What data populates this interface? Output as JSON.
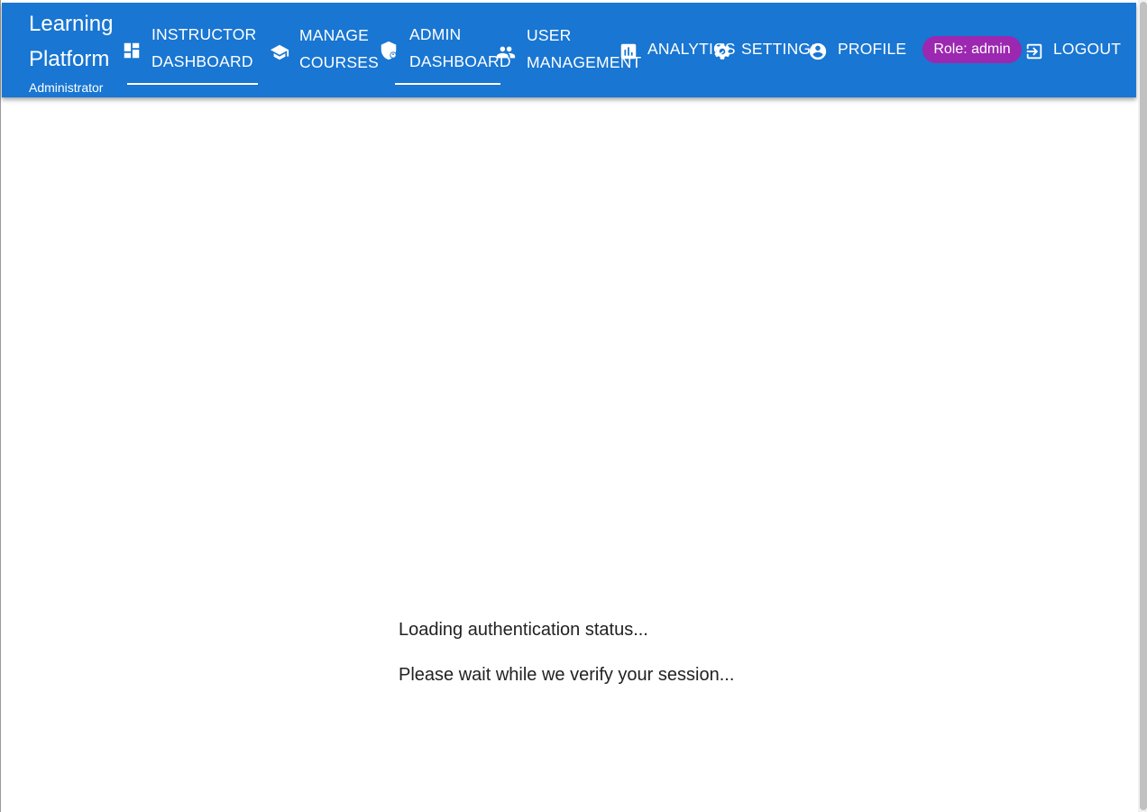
{
  "app": {
    "title": "Learning Platform",
    "subtitle": "Administrator"
  },
  "nav": {
    "instructor_dashboard": {
      "line1": "INSTRUCTOR",
      "line2": "DASHBOARD",
      "icon": "dashboard-icon"
    },
    "manage_courses": {
      "line1": "MANAGE",
      "line2": "COURSES",
      "icon": "school-icon"
    },
    "admin_dashboard": {
      "line1": "ADMIN",
      "line2": "DASHBOARD",
      "icon": "admin-shield-icon"
    },
    "user_management": {
      "line1": "USER",
      "line2": "MANAGEMENT",
      "icon": "people-icon"
    },
    "analytics": {
      "label": "ANALYTICS",
      "icon": "bar-chart-icon"
    },
    "settings": {
      "label": "SETTINGS",
      "icon": "gear-icon"
    },
    "profile": {
      "label": "PROFILE",
      "icon": "account-circle-icon"
    },
    "logout": {
      "label": "LOGOUT",
      "icon": "logout-icon"
    }
  },
  "role_badge": {
    "label": "Role: admin",
    "color": "#9c27b0"
  },
  "status": {
    "loading": "Loading authentication status...",
    "wait": "Please wait while we verify your session..."
  },
  "colors": {
    "appbar": "#1976d2",
    "text_on_appbar": "#ffffff",
    "body_text": "#222222"
  }
}
